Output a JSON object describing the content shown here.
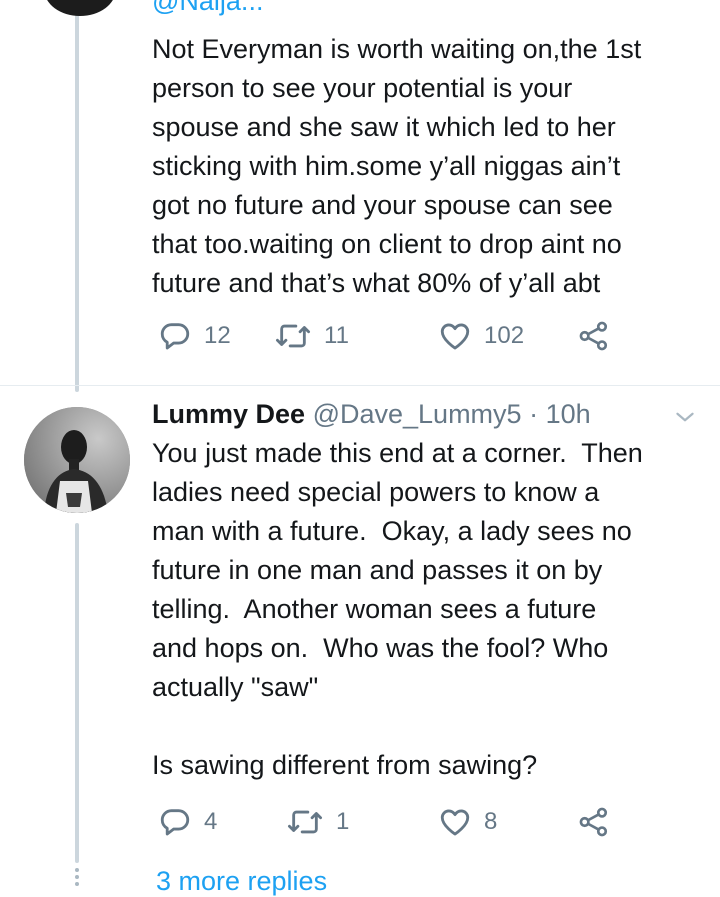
{
  "tweet1": {
    "handle_clipped": "@Naija...",
    "text": "Not Everyman is worth waiting on,the 1st\nperson to see your potential is your\nspouse and she saw it which led to her\nsticking with him.some y’all niggas ain’t\ngot no future and your spouse can see\nthat too.waiting on client to drop aint no\nfuture and that’s what 80% of y’all abt",
    "replies": "12",
    "retweets": "11",
    "likes": "102"
  },
  "tweet2": {
    "name": "Lummy Dee",
    "handle": "@Dave_Lummy5",
    "separator": "·",
    "time": "10h",
    "text": "You just made this end at a corner.  Then\nladies need special powers to know a\nman with a future.  Okay, a lady sees no\nfuture in one man and passes it on by\ntelling.  Another woman sees a future\nand hops on.  Who was the fool? Who\nactually \"saw\"\n\nIs sawing different from sawing?",
    "replies": "4",
    "retweets": "1",
    "likes": "8"
  },
  "more_replies": "3 more replies",
  "icons": {
    "reply": "reply-icon",
    "retweet": "retweet-icon",
    "like": "heart-icon",
    "share": "share-icon",
    "menu": "chevron-down-icon"
  },
  "colors": {
    "text": "#14171a",
    "muted": "#657786",
    "link": "#1da1f2",
    "divider": "#e6ecf0",
    "thread_line": "#ccd6dd"
  }
}
